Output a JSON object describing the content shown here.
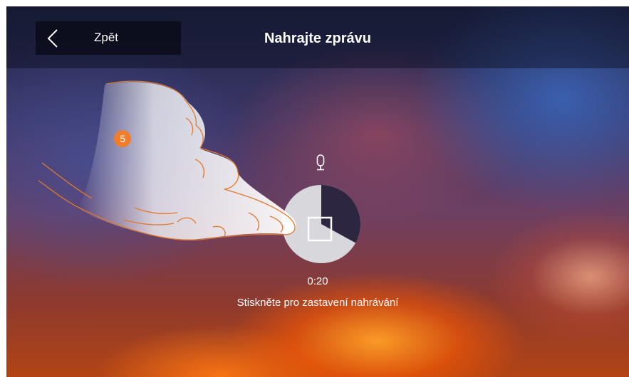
{
  "header": {
    "back_label": "Zpět",
    "title": "Nahrajte zprávu"
  },
  "recorder": {
    "icon": "microphone-icon",
    "timer": "0:20",
    "progress_fraction": 0.33,
    "hint": "Stiskněte pro zastavení nahrávání"
  },
  "annotation": {
    "step_number": "5"
  },
  "colors": {
    "dial_fill": "#d7d7dc",
    "dial_progress": "#2d2640",
    "step_badge": "#ef7d2c",
    "hand_outline": "#e2782a"
  }
}
